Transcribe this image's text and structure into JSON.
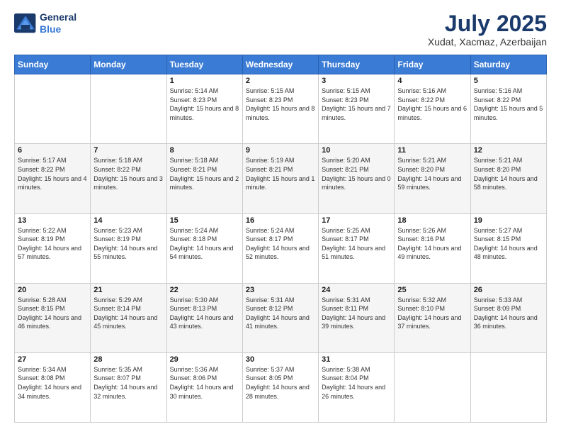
{
  "logo": {
    "line1": "General",
    "line2": "Blue"
  },
  "title": "July 2025",
  "subtitle": "Xudat, Xacmaz, Azerbaijan",
  "weekdays": [
    "Sunday",
    "Monday",
    "Tuesday",
    "Wednesday",
    "Thursday",
    "Friday",
    "Saturday"
  ],
  "weeks": [
    [
      {
        "day": "",
        "sunrise": "",
        "sunset": "",
        "daylight": ""
      },
      {
        "day": "",
        "sunrise": "",
        "sunset": "",
        "daylight": ""
      },
      {
        "day": "1",
        "sunrise": "Sunrise: 5:14 AM",
        "sunset": "Sunset: 8:23 PM",
        "daylight": "Daylight: 15 hours and 8 minutes."
      },
      {
        "day": "2",
        "sunrise": "Sunrise: 5:15 AM",
        "sunset": "Sunset: 8:23 PM",
        "daylight": "Daylight: 15 hours and 8 minutes."
      },
      {
        "day": "3",
        "sunrise": "Sunrise: 5:15 AM",
        "sunset": "Sunset: 8:23 PM",
        "daylight": "Daylight: 15 hours and 7 minutes."
      },
      {
        "day": "4",
        "sunrise": "Sunrise: 5:16 AM",
        "sunset": "Sunset: 8:22 PM",
        "daylight": "Daylight: 15 hours and 6 minutes."
      },
      {
        "day": "5",
        "sunrise": "Sunrise: 5:16 AM",
        "sunset": "Sunset: 8:22 PM",
        "daylight": "Daylight: 15 hours and 5 minutes."
      }
    ],
    [
      {
        "day": "6",
        "sunrise": "Sunrise: 5:17 AM",
        "sunset": "Sunset: 8:22 PM",
        "daylight": "Daylight: 15 hours and 4 minutes."
      },
      {
        "day": "7",
        "sunrise": "Sunrise: 5:18 AM",
        "sunset": "Sunset: 8:22 PM",
        "daylight": "Daylight: 15 hours and 3 minutes."
      },
      {
        "day": "8",
        "sunrise": "Sunrise: 5:18 AM",
        "sunset": "Sunset: 8:21 PM",
        "daylight": "Daylight: 15 hours and 2 minutes."
      },
      {
        "day": "9",
        "sunrise": "Sunrise: 5:19 AM",
        "sunset": "Sunset: 8:21 PM",
        "daylight": "Daylight: 15 hours and 1 minute."
      },
      {
        "day": "10",
        "sunrise": "Sunrise: 5:20 AM",
        "sunset": "Sunset: 8:21 PM",
        "daylight": "Daylight: 15 hours and 0 minutes."
      },
      {
        "day": "11",
        "sunrise": "Sunrise: 5:21 AM",
        "sunset": "Sunset: 8:20 PM",
        "daylight": "Daylight: 14 hours and 59 minutes."
      },
      {
        "day": "12",
        "sunrise": "Sunrise: 5:21 AM",
        "sunset": "Sunset: 8:20 PM",
        "daylight": "Daylight: 14 hours and 58 minutes."
      }
    ],
    [
      {
        "day": "13",
        "sunrise": "Sunrise: 5:22 AM",
        "sunset": "Sunset: 8:19 PM",
        "daylight": "Daylight: 14 hours and 57 minutes."
      },
      {
        "day": "14",
        "sunrise": "Sunrise: 5:23 AM",
        "sunset": "Sunset: 8:19 PM",
        "daylight": "Daylight: 14 hours and 55 minutes."
      },
      {
        "day": "15",
        "sunrise": "Sunrise: 5:24 AM",
        "sunset": "Sunset: 8:18 PM",
        "daylight": "Daylight: 14 hours and 54 minutes."
      },
      {
        "day": "16",
        "sunrise": "Sunrise: 5:24 AM",
        "sunset": "Sunset: 8:17 PM",
        "daylight": "Daylight: 14 hours and 52 minutes."
      },
      {
        "day": "17",
        "sunrise": "Sunrise: 5:25 AM",
        "sunset": "Sunset: 8:17 PM",
        "daylight": "Daylight: 14 hours and 51 minutes."
      },
      {
        "day": "18",
        "sunrise": "Sunrise: 5:26 AM",
        "sunset": "Sunset: 8:16 PM",
        "daylight": "Daylight: 14 hours and 49 minutes."
      },
      {
        "day": "19",
        "sunrise": "Sunrise: 5:27 AM",
        "sunset": "Sunset: 8:15 PM",
        "daylight": "Daylight: 14 hours and 48 minutes."
      }
    ],
    [
      {
        "day": "20",
        "sunrise": "Sunrise: 5:28 AM",
        "sunset": "Sunset: 8:15 PM",
        "daylight": "Daylight: 14 hours and 46 minutes."
      },
      {
        "day": "21",
        "sunrise": "Sunrise: 5:29 AM",
        "sunset": "Sunset: 8:14 PM",
        "daylight": "Daylight: 14 hours and 45 minutes."
      },
      {
        "day": "22",
        "sunrise": "Sunrise: 5:30 AM",
        "sunset": "Sunset: 8:13 PM",
        "daylight": "Daylight: 14 hours and 43 minutes."
      },
      {
        "day": "23",
        "sunrise": "Sunrise: 5:31 AM",
        "sunset": "Sunset: 8:12 PM",
        "daylight": "Daylight: 14 hours and 41 minutes."
      },
      {
        "day": "24",
        "sunrise": "Sunrise: 5:31 AM",
        "sunset": "Sunset: 8:11 PM",
        "daylight": "Daylight: 14 hours and 39 minutes."
      },
      {
        "day": "25",
        "sunrise": "Sunrise: 5:32 AM",
        "sunset": "Sunset: 8:10 PM",
        "daylight": "Daylight: 14 hours and 37 minutes."
      },
      {
        "day": "26",
        "sunrise": "Sunrise: 5:33 AM",
        "sunset": "Sunset: 8:09 PM",
        "daylight": "Daylight: 14 hours and 36 minutes."
      }
    ],
    [
      {
        "day": "27",
        "sunrise": "Sunrise: 5:34 AM",
        "sunset": "Sunset: 8:08 PM",
        "daylight": "Daylight: 14 hours and 34 minutes."
      },
      {
        "day": "28",
        "sunrise": "Sunrise: 5:35 AM",
        "sunset": "Sunset: 8:07 PM",
        "daylight": "Daylight: 14 hours and 32 minutes."
      },
      {
        "day": "29",
        "sunrise": "Sunrise: 5:36 AM",
        "sunset": "Sunset: 8:06 PM",
        "daylight": "Daylight: 14 hours and 30 minutes."
      },
      {
        "day": "30",
        "sunrise": "Sunrise: 5:37 AM",
        "sunset": "Sunset: 8:05 PM",
        "daylight": "Daylight: 14 hours and 28 minutes."
      },
      {
        "day": "31",
        "sunrise": "Sunrise: 5:38 AM",
        "sunset": "Sunset: 8:04 PM",
        "daylight": "Daylight: 14 hours and 26 minutes."
      },
      {
        "day": "",
        "sunrise": "",
        "sunset": "",
        "daylight": ""
      },
      {
        "day": "",
        "sunrise": "",
        "sunset": "",
        "daylight": ""
      }
    ]
  ]
}
